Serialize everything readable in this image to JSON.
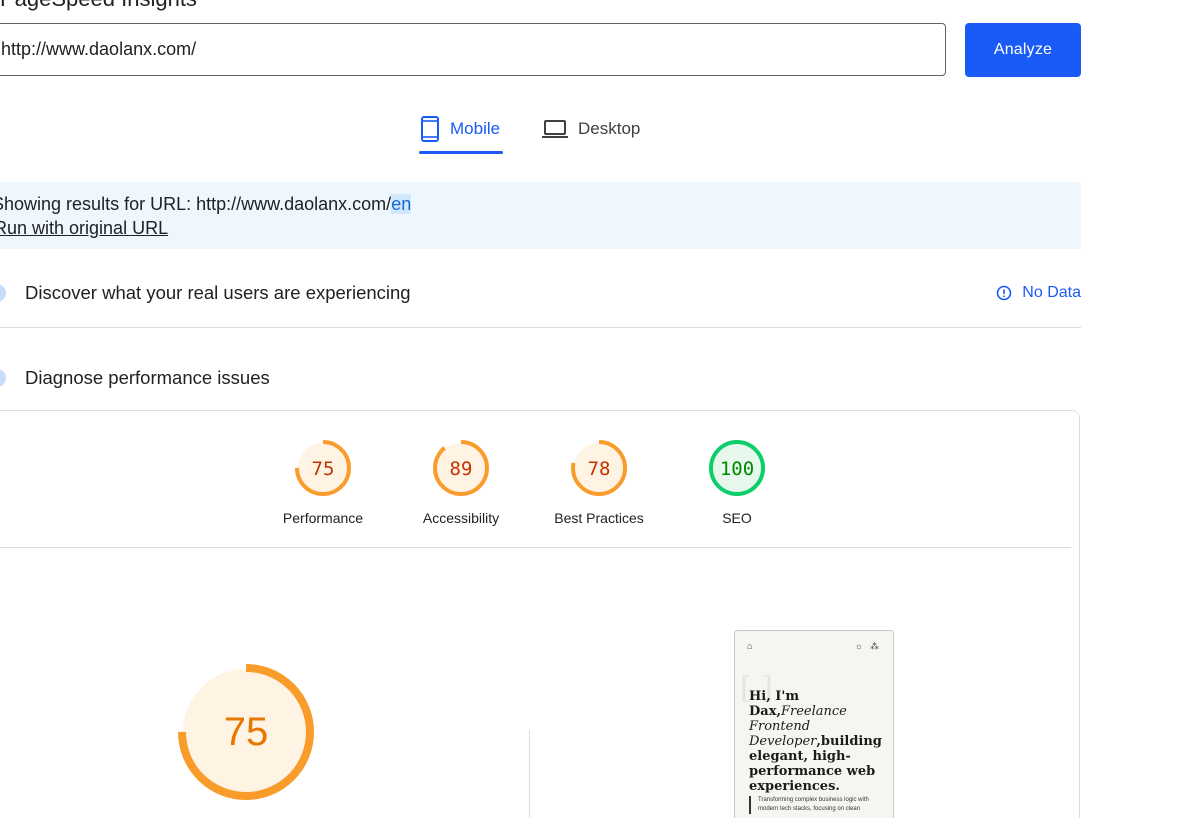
{
  "header": {
    "top_heading": "PageSpeed Insights"
  },
  "search": {
    "url_value": "http://www.daolanx.com/",
    "analyze_label": "Analyze"
  },
  "tabs": [
    {
      "label": "Mobile",
      "active": true,
      "icon": "smartphone-icon"
    },
    {
      "label": "Desktop",
      "active": false,
      "icon": "laptop-icon"
    }
  ],
  "banner": {
    "prefix": "Showing results for URL: http://www.daolanx.com/",
    "highlight": "en",
    "run_link": "Run with original URL"
  },
  "sections": {
    "real_users_title": "Discover what your real users are experiencing",
    "no_data_label": "No Data",
    "diagnose_title": "Diagnose performance issues"
  },
  "scores": [
    {
      "label": "Performance",
      "value": 75,
      "status": "average"
    },
    {
      "label": "Accessibility",
      "value": 89,
      "status": "average"
    },
    {
      "label": "Best Practices",
      "value": 78,
      "status": "average"
    },
    {
      "label": "SEO",
      "value": 100,
      "status": "pass"
    }
  ],
  "main_score": {
    "value": 75
  },
  "colors": {
    "accent": "#1a5af7",
    "average_stroke": "#fa9c2c",
    "average_fill": "#fff3e3",
    "average_text": "#c33300",
    "pass_stroke": "#0cce6b",
    "pass_fill": "#e6f7ec",
    "pass_text": "#008800"
  },
  "preview": {
    "heading_1": "Hi, I'm Dax,",
    "heading_2_italic": "Freelance Frontend Developer",
    "heading_3": ",building elegant, high-performance web experiences.",
    "quote": "Transforming complex business logic with modern tech stacks, focusing on clean"
  }
}
